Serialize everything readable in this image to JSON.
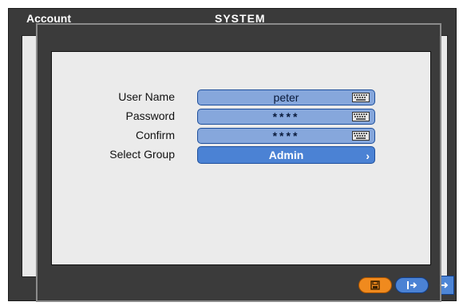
{
  "background_window": {
    "title": "Account",
    "section": "SYSTEM"
  },
  "dialog": {
    "fields": [
      {
        "label": "User Name",
        "value": "peter",
        "icon": "keyboard-icon"
      },
      {
        "label": "Password",
        "value": "****",
        "icon": "keyboard-icon"
      },
      {
        "label": "Confirm",
        "value": "****",
        "icon": "keyboard-icon"
      }
    ],
    "select_group": {
      "label": "Select Group",
      "value": "Admin",
      "icon": "chevron-right-icon"
    },
    "buttons": {
      "save_icon": "save-icon",
      "exit_icon": "exit-icon"
    }
  },
  "colors": {
    "field_bg": "#86a7dc",
    "select_bg": "#4b82d4",
    "save_button": "#f08a1e",
    "exit_button": "#4b82d4"
  }
}
